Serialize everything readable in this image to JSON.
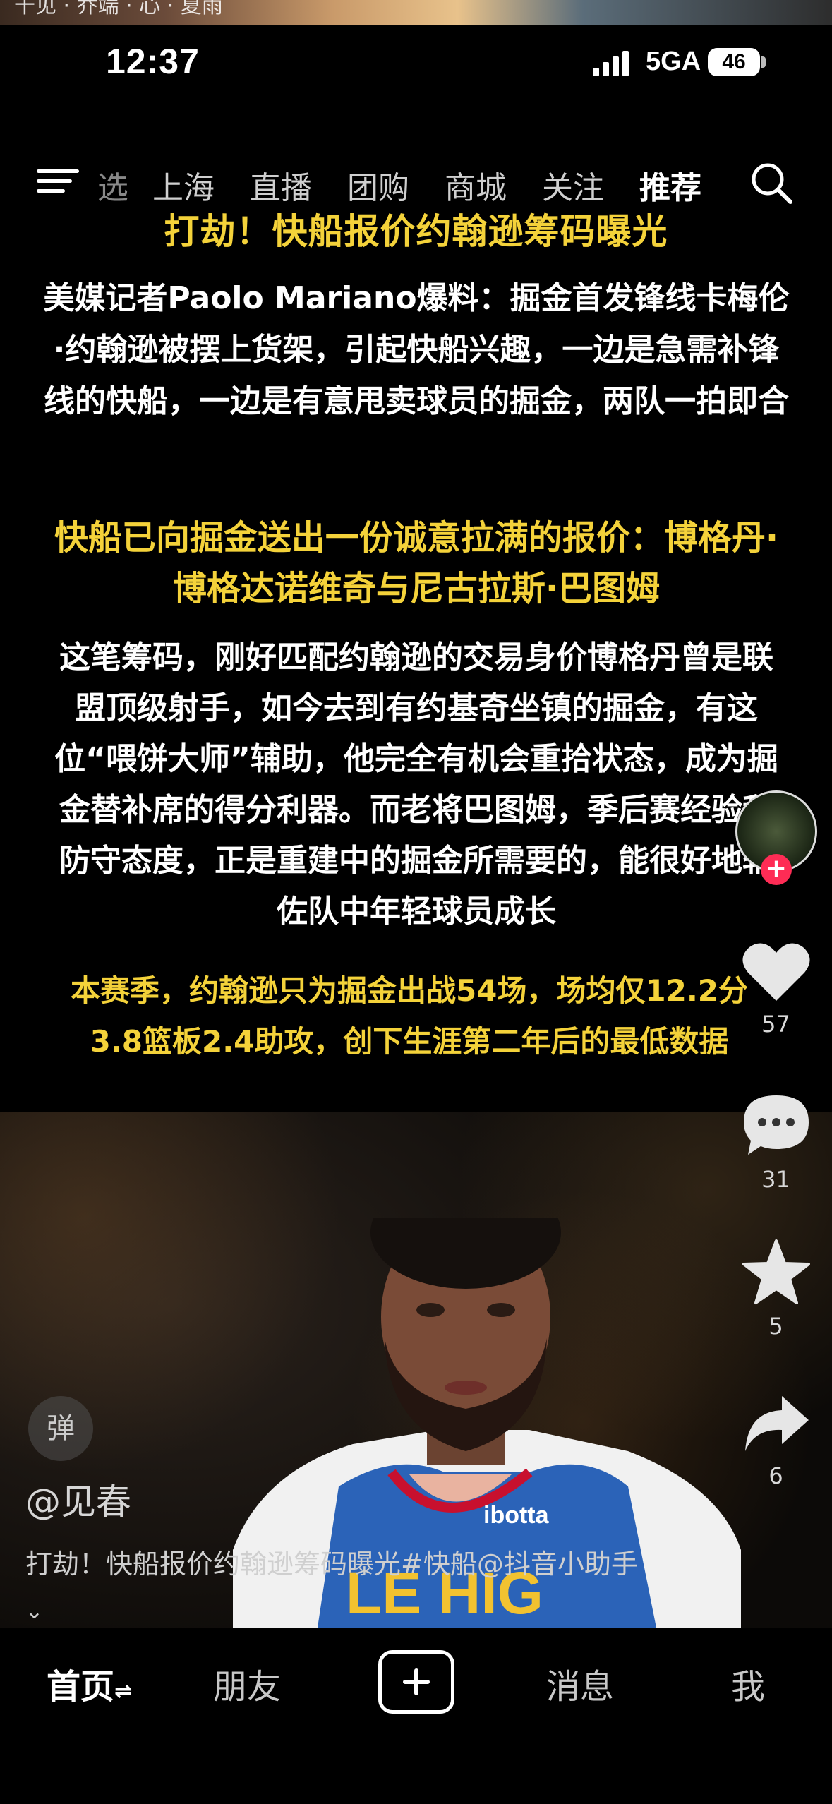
{
  "overlay_title": "千见 · 乔端 · 心 · 夏雨",
  "status_bar": {
    "time": "12:37",
    "network": "5GA",
    "battery": "46"
  },
  "top_nav": {
    "tabs": [
      {
        "label": "上海"
      },
      {
        "label": "直播"
      },
      {
        "label": "团购"
      },
      {
        "label": "商城"
      },
      {
        "label": "关注"
      },
      {
        "label": "推荐"
      }
    ],
    "partial_tab": "选"
  },
  "post": {
    "headline": "打劫！快船报价约翰逊筹码曝光",
    "paragraph1": "美媒记者Paolo Mariano爆料：掘金首发锋线卡梅伦·约翰逊被摆上货架，引起快船兴趣，一边是急需补锋线的快船，一边是有意甩卖球员的掘金，两队一拍即合",
    "highlight1": "快船已向掘金送出一份诚意拉满的报价：博格丹·博格达诺维奇与尼古拉斯·巴图姆",
    "paragraph2": "这笔筹码，刚好匹配约翰逊的交易身价博格丹曾是联盟顶级射手，如今去到有约基奇坐镇的掘金，有这位“喂饼大师”辅助，他完全有机会重拾状态，成为掘金替补席的得分利器。而老将巴图姆，季后赛经验和防守态度，正是重建中的掘金所需要的，能很好地辅佐队中年轻球员成长",
    "highlight2": "本赛季，约翰逊只为掘金出战54场，场均仅12.2分3.8篮板2.4助攻，创下生涯第二年后的最低数据",
    "author": "@见春",
    "caption": "打劫！快船报价约翰逊筹码曝光#快船@抖音小助手",
    "danmu_label": "弹"
  },
  "actions": {
    "likes": "57",
    "comments": "31",
    "favorites": "5",
    "shares": "6"
  },
  "bottom_nav": {
    "home": "首页",
    "home_suffix": "⇌",
    "friends": "朋友",
    "messages": "消息",
    "me": "我"
  },
  "colors": {
    "highlight": "#f4d23a",
    "follow": "#fe2c55",
    "background": "#000000"
  }
}
